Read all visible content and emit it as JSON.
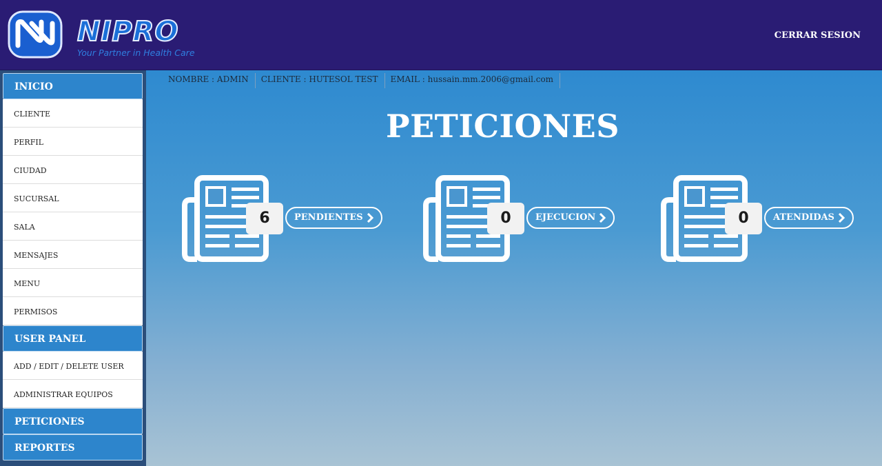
{
  "header": {
    "brand": "NIPRO",
    "tagline": "Your Partner in Health Care",
    "logout_label": "CERRAR SESION"
  },
  "sidebar": {
    "sections": [
      {
        "label": "INICIO",
        "items": [
          "CLIENTE",
          "PERFIL",
          "CIUDAD",
          "SUCURSAL",
          "SALA",
          "MENSAJES",
          "MENU",
          "PERMISOS"
        ]
      },
      {
        "label": "USER PANEL",
        "items": [
          "ADD / EDIT / DELETE USER",
          "ADMINISTRAR EQUIPOS"
        ]
      },
      {
        "label": "PETICIONES",
        "items": []
      },
      {
        "label": "REPORTES",
        "items": []
      }
    ]
  },
  "info_bar": {
    "nombre": "NOMBRE : ADMIN",
    "cliente": "CLIENTE : HUTESOL TEST",
    "email": "EMAIL : hussain.mm.2006@gmail.com"
  },
  "main": {
    "title": "PETICIONES",
    "cards": [
      {
        "count": "6",
        "label": "PENDIENTES",
        "icon": "newspaper-icon"
      },
      {
        "count": "0",
        "label": "EJECUCION",
        "icon": "newspaper-icon"
      },
      {
        "count": "0",
        "label": "ATENDIDAS",
        "icon": "newspaper-icon"
      }
    ]
  },
  "colors": {
    "header_bg": "#2a1c74",
    "sidebar_head": "#2d85cc",
    "main_top": "#2e8ad0",
    "main_bottom": "#a8c3d4"
  }
}
